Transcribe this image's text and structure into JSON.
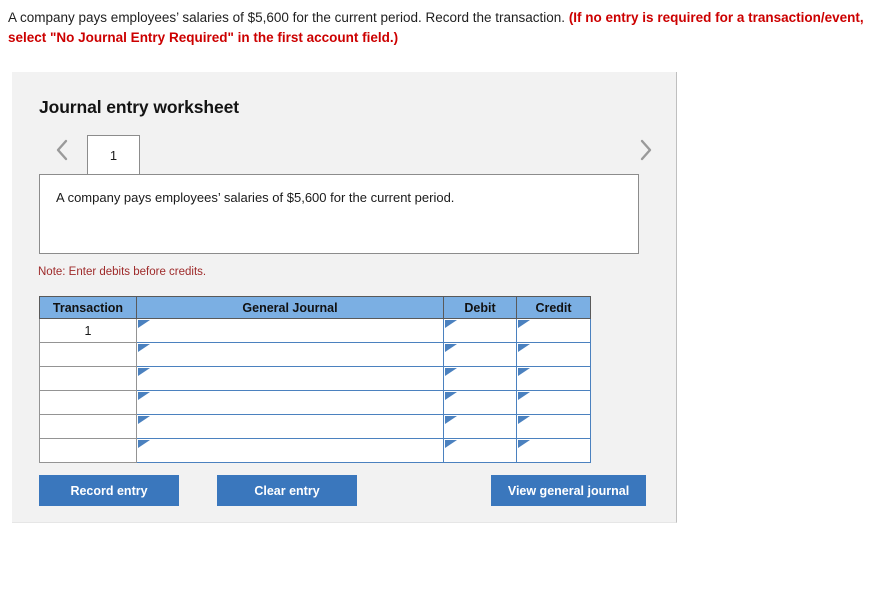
{
  "question": {
    "text_plain": "A company pays employees’ salaries of $5,600 for the current period. Record the transaction. ",
    "text_emphasis": "(If no entry is required for a transaction/event, select \"No Journal Entry Required\" in the first account field.)"
  },
  "worksheet": {
    "title": "Journal entry worksheet",
    "tabs": [
      {
        "label": "1",
        "selected": true
      }
    ],
    "nav": {
      "prev_icon": "chevron-left-icon",
      "next_icon": "chevron-right-icon"
    },
    "description": "A company pays employees’ salaries of $5,600 for the current period.",
    "note": "Note: Enter debits before credits.",
    "table": {
      "columns": [
        "Transaction",
        "General Journal",
        "Debit",
        "Credit"
      ],
      "rows": [
        {
          "transaction": "1",
          "general_journal": "",
          "debit": "",
          "credit": ""
        },
        {
          "transaction": "",
          "general_journal": "",
          "debit": "",
          "credit": ""
        },
        {
          "transaction": "",
          "general_journal": "",
          "debit": "",
          "credit": ""
        },
        {
          "transaction": "",
          "general_journal": "",
          "debit": "",
          "credit": ""
        },
        {
          "transaction": "",
          "general_journal": "",
          "debit": "",
          "credit": ""
        },
        {
          "transaction": "",
          "general_journal": "",
          "debit": "",
          "credit": ""
        }
      ]
    },
    "buttons": {
      "record_entry": "Record entry",
      "clear_entry": "Clear entry",
      "view_general_journal": "View general journal"
    }
  },
  "colors": {
    "emphasis_red": "#cc0000",
    "note_red": "#9e2a2a",
    "button_blue": "#3a77bd",
    "table_header_blue": "#7bafe3",
    "input_border_blue": "#4b81bf",
    "panel_gray": "#f2f2f2"
  }
}
